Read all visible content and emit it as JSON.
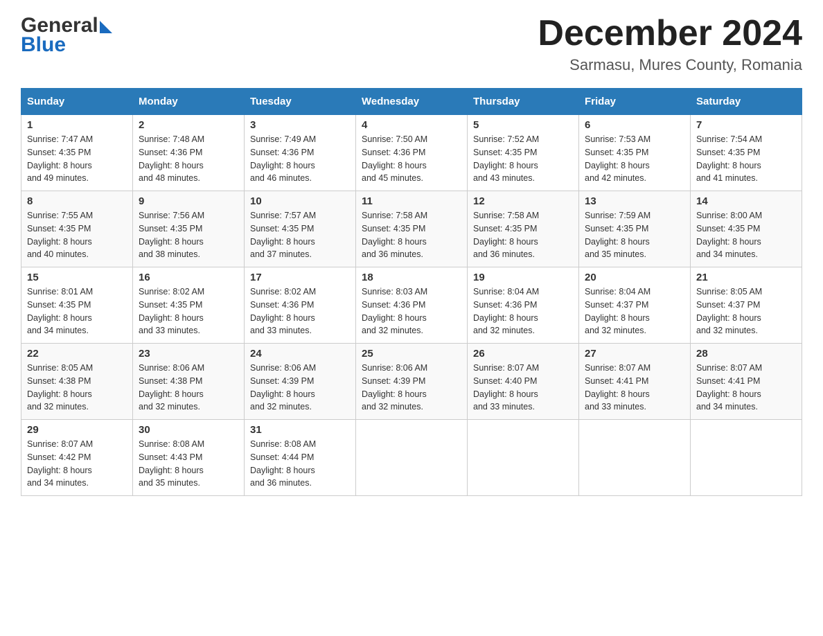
{
  "logo": {
    "general": "General",
    "blue": "Blue"
  },
  "title": "December 2024",
  "subtitle": "Sarmasu, Mures County, Romania",
  "days_of_week": [
    "Sunday",
    "Monday",
    "Tuesday",
    "Wednesday",
    "Thursday",
    "Friday",
    "Saturday"
  ],
  "weeks": [
    [
      {
        "num": "1",
        "sunrise": "7:47 AM",
        "sunset": "4:35 PM",
        "daylight": "8 hours and 49 minutes."
      },
      {
        "num": "2",
        "sunrise": "7:48 AM",
        "sunset": "4:36 PM",
        "daylight": "8 hours and 48 minutes."
      },
      {
        "num": "3",
        "sunrise": "7:49 AM",
        "sunset": "4:36 PM",
        "daylight": "8 hours and 46 minutes."
      },
      {
        "num": "4",
        "sunrise": "7:50 AM",
        "sunset": "4:36 PM",
        "daylight": "8 hours and 45 minutes."
      },
      {
        "num": "5",
        "sunrise": "7:52 AM",
        "sunset": "4:35 PM",
        "daylight": "8 hours and 43 minutes."
      },
      {
        "num": "6",
        "sunrise": "7:53 AM",
        "sunset": "4:35 PM",
        "daylight": "8 hours and 42 minutes."
      },
      {
        "num": "7",
        "sunrise": "7:54 AM",
        "sunset": "4:35 PM",
        "daylight": "8 hours and 41 minutes."
      }
    ],
    [
      {
        "num": "8",
        "sunrise": "7:55 AM",
        "sunset": "4:35 PM",
        "daylight": "8 hours and 40 minutes."
      },
      {
        "num": "9",
        "sunrise": "7:56 AM",
        "sunset": "4:35 PM",
        "daylight": "8 hours and 38 minutes."
      },
      {
        "num": "10",
        "sunrise": "7:57 AM",
        "sunset": "4:35 PM",
        "daylight": "8 hours and 37 minutes."
      },
      {
        "num": "11",
        "sunrise": "7:58 AM",
        "sunset": "4:35 PM",
        "daylight": "8 hours and 36 minutes."
      },
      {
        "num": "12",
        "sunrise": "7:58 AM",
        "sunset": "4:35 PM",
        "daylight": "8 hours and 36 minutes."
      },
      {
        "num": "13",
        "sunrise": "7:59 AM",
        "sunset": "4:35 PM",
        "daylight": "8 hours and 35 minutes."
      },
      {
        "num": "14",
        "sunrise": "8:00 AM",
        "sunset": "4:35 PM",
        "daylight": "8 hours and 34 minutes."
      }
    ],
    [
      {
        "num": "15",
        "sunrise": "8:01 AM",
        "sunset": "4:35 PM",
        "daylight": "8 hours and 34 minutes."
      },
      {
        "num": "16",
        "sunrise": "8:02 AM",
        "sunset": "4:35 PM",
        "daylight": "8 hours and 33 minutes."
      },
      {
        "num": "17",
        "sunrise": "8:02 AM",
        "sunset": "4:36 PM",
        "daylight": "8 hours and 33 minutes."
      },
      {
        "num": "18",
        "sunrise": "8:03 AM",
        "sunset": "4:36 PM",
        "daylight": "8 hours and 32 minutes."
      },
      {
        "num": "19",
        "sunrise": "8:04 AM",
        "sunset": "4:36 PM",
        "daylight": "8 hours and 32 minutes."
      },
      {
        "num": "20",
        "sunrise": "8:04 AM",
        "sunset": "4:37 PM",
        "daylight": "8 hours and 32 minutes."
      },
      {
        "num": "21",
        "sunrise": "8:05 AM",
        "sunset": "4:37 PM",
        "daylight": "8 hours and 32 minutes."
      }
    ],
    [
      {
        "num": "22",
        "sunrise": "8:05 AM",
        "sunset": "4:38 PM",
        "daylight": "8 hours and 32 minutes."
      },
      {
        "num": "23",
        "sunrise": "8:06 AM",
        "sunset": "4:38 PM",
        "daylight": "8 hours and 32 minutes."
      },
      {
        "num": "24",
        "sunrise": "8:06 AM",
        "sunset": "4:39 PM",
        "daylight": "8 hours and 32 minutes."
      },
      {
        "num": "25",
        "sunrise": "8:06 AM",
        "sunset": "4:39 PM",
        "daylight": "8 hours and 32 minutes."
      },
      {
        "num": "26",
        "sunrise": "8:07 AM",
        "sunset": "4:40 PM",
        "daylight": "8 hours and 33 minutes."
      },
      {
        "num": "27",
        "sunrise": "8:07 AM",
        "sunset": "4:41 PM",
        "daylight": "8 hours and 33 minutes."
      },
      {
        "num": "28",
        "sunrise": "8:07 AM",
        "sunset": "4:41 PM",
        "daylight": "8 hours and 34 minutes."
      }
    ],
    [
      {
        "num": "29",
        "sunrise": "8:07 AM",
        "sunset": "4:42 PM",
        "daylight": "8 hours and 34 minutes."
      },
      {
        "num": "30",
        "sunrise": "8:08 AM",
        "sunset": "4:43 PM",
        "daylight": "8 hours and 35 minutes."
      },
      {
        "num": "31",
        "sunrise": "8:08 AM",
        "sunset": "4:44 PM",
        "daylight": "8 hours and 36 minutes."
      },
      null,
      null,
      null,
      null
    ]
  ],
  "labels": {
    "sunrise": "Sunrise:",
    "sunset": "Sunset:",
    "daylight": "Daylight:"
  }
}
